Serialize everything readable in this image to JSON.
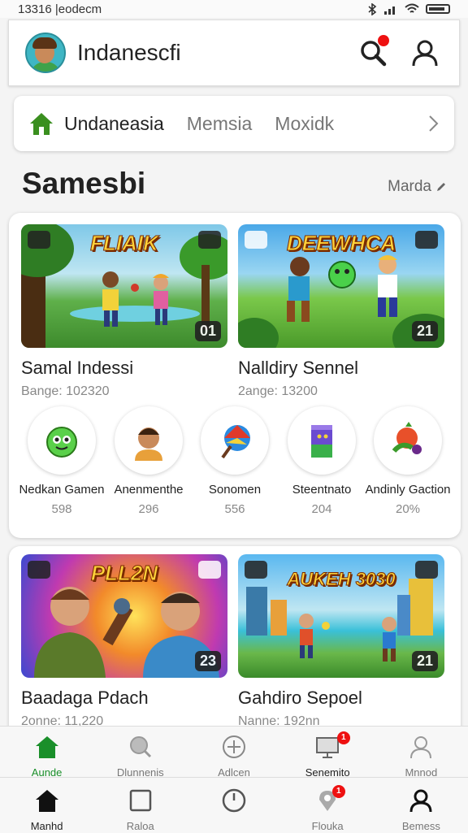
{
  "status_bar": {
    "time": "13316 |eodecm"
  },
  "app_bar": {
    "title": "Indanescfi"
  },
  "region_tabs": [
    "Undaneasia",
    "Memsia",
    "Moxidk"
  ],
  "section": {
    "title": "Samesbi",
    "more_label": "Marda"
  },
  "featured": [
    {
      "thumb_title": "FLIAIK",
      "badge": "01",
      "name": "Samal Indessi",
      "sub": "Bange: 102320"
    },
    {
      "thumb_title": "DEEWHCA",
      "badge": "21",
      "name": "Nalldiry Sennel",
      "sub": "2ange: 13200"
    }
  ],
  "categories": [
    {
      "label": "Nedkan Gamen",
      "count": "598"
    },
    {
      "label": "Anenmenthe",
      "count": "296"
    },
    {
      "label": "Sonomen",
      "count": "556"
    },
    {
      "label": "Steentnato",
      "count": "204"
    },
    {
      "label": "Andinly Gaction",
      "count": "20%"
    }
  ],
  "more_games": [
    {
      "thumb_title": "PLL2N",
      "badge": "23",
      "name": "Baadaga Pdach",
      "sub": "2onne: 11,220"
    },
    {
      "thumb_title": "AUKEH 3030",
      "badge": "21",
      "name": "Gahdiro Sepoel",
      "sub": "Nanne: 192nn"
    }
  ],
  "nav_top": [
    {
      "label": "Aunde",
      "icon": "home-icon",
      "active": true
    },
    {
      "label": "Dlunnenis",
      "icon": "search-icon"
    },
    {
      "label": "Adlcen",
      "icon": "add-icon"
    },
    {
      "label": "Senemito",
      "icon": "tv-icon",
      "badge": "1"
    },
    {
      "label": "Mnnod",
      "icon": "user-icon"
    }
  ],
  "nav_bottom": [
    {
      "label": "Manhd",
      "icon": "home-icon"
    },
    {
      "label": "Raloa",
      "icon": "square-icon"
    },
    {
      "label": "",
      "icon": "clock-icon"
    },
    {
      "label": "Flouka",
      "icon": "pin-icon",
      "badge": "1"
    },
    {
      "label": "Bemess",
      "icon": "user-icon"
    }
  ],
  "colors": {
    "accent_green": "#1a8f2a",
    "notification_red": "#e11111"
  }
}
